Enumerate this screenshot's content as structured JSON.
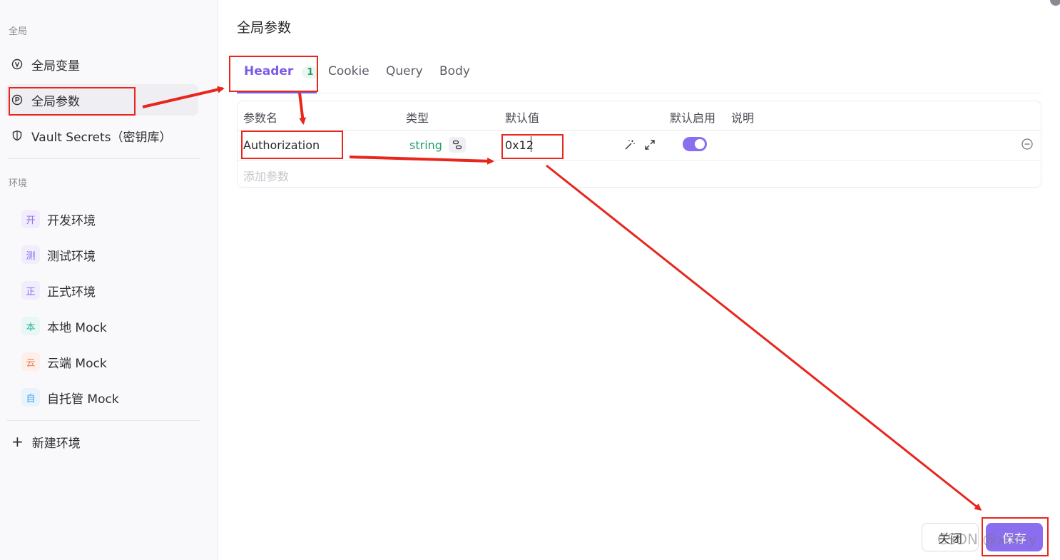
{
  "sidebar": {
    "global_label": "全局",
    "items": [
      {
        "label": "全局变量",
        "icon": "variable-v-icon"
      },
      {
        "label": "全局参数",
        "icon": "parameter-p-icon"
      },
      {
        "label": "Vault Secrets（密钥库）",
        "icon": "shield-icon"
      }
    ],
    "env_label": "环境",
    "environments": [
      {
        "badge": "开",
        "label": "开发环境",
        "badge_color": "#8b6df0",
        "badge_bg": "#f1edfd"
      },
      {
        "badge": "测",
        "label": "测试环境",
        "badge_color": "#8b6df0",
        "badge_bg": "#f1edfd"
      },
      {
        "badge": "正",
        "label": "正式环境",
        "badge_color": "#8b6df0",
        "badge_bg": "#f1edfd"
      },
      {
        "badge": "本",
        "label": "本地 Mock",
        "badge_color": "#2bb5a0",
        "badge_bg": "#e8f7f4"
      },
      {
        "badge": "云",
        "label": "云端 Mock",
        "badge_color": "#f07a4b",
        "badge_bg": "#fdefe9"
      },
      {
        "badge": "自",
        "label": "自托管 Mock",
        "badge_color": "#3f9ee8",
        "badge_bg": "#e9f3fc"
      }
    ],
    "new_env": "新建环境"
  },
  "main": {
    "title": "全局参数",
    "tabs": [
      {
        "label": "Header",
        "count": "1"
      },
      {
        "label": "Cookie"
      },
      {
        "label": "Query"
      },
      {
        "label": "Body"
      }
    ],
    "table": {
      "headers": {
        "name": "参数名",
        "type": "类型",
        "default": "默认值",
        "enabled": "默认启用",
        "desc": "说明"
      },
      "rows": [
        {
          "name": "Authorization",
          "type": "string",
          "default": "0x12",
          "enabled": true
        }
      ],
      "add_placeholder": "添加参数"
    }
  },
  "footer": {
    "close": "关闭",
    "save": "保存",
    "watermark": "CSDN @xrkhy"
  },
  "colors": {
    "accent": "#8b6df0",
    "type_green": "#22a06b",
    "annotation_red": "#e8261c"
  }
}
